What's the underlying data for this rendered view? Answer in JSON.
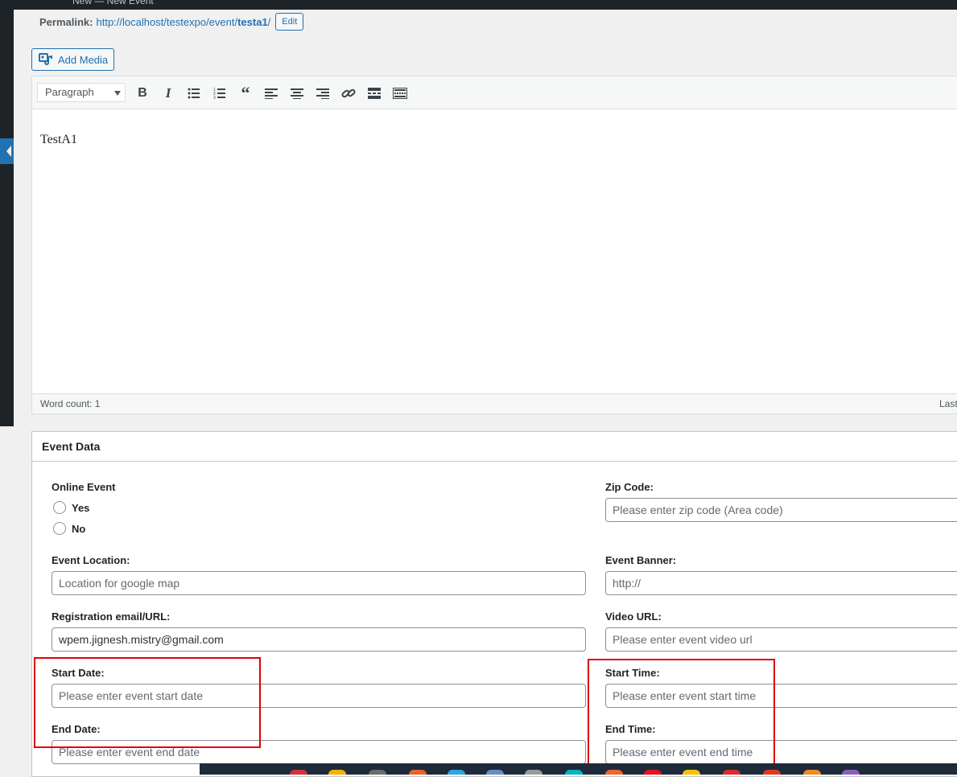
{
  "topbar": {
    "crumb": "New — New Event"
  },
  "permalink": {
    "label": "Permalink:",
    "url_base": "http://localhost/testexpo/event/",
    "slug": "testa1",
    "url_end": "/",
    "edit_label": "Edit"
  },
  "media": {
    "add_label": "Add Media"
  },
  "editor": {
    "format_value": "Paragraph",
    "toolbar_icons": [
      "bold-icon",
      "italic-icon",
      "bulleted-list-icon",
      "numbered-list-icon",
      "blockquote-icon",
      "align-left-icon",
      "align-center-icon",
      "align-right-icon",
      "link-icon",
      "read-more-icon",
      "toolbar-toggle-icon"
    ],
    "content": "TestA1",
    "word_count": "Word count: 1",
    "last_edited": "Last"
  },
  "event_data": {
    "title": "Event Data",
    "online_event": {
      "label": "Online Event",
      "option_yes": "Yes",
      "option_no": "No"
    },
    "zip_code": {
      "label": "Zip Code:",
      "placeholder": "Please enter zip code (Area code)"
    },
    "event_location": {
      "label": "Event Location:",
      "placeholder": "Location for google map"
    },
    "event_banner": {
      "label": "Event Banner:",
      "placeholder": "http://"
    },
    "registration": {
      "label": "Registration email/URL:",
      "value": "wpem.jignesh.mistry@gmail.com"
    },
    "video_url": {
      "label": "Video URL:",
      "placeholder": "Please enter event video url"
    },
    "start_date": {
      "label": "Start Date:",
      "placeholder": "Please enter event start date"
    },
    "start_time": {
      "label": "Start Time:",
      "placeholder": "Please enter event start time"
    },
    "end_date": {
      "label": "End Date:",
      "placeholder": "Please enter event end date"
    },
    "end_time": {
      "label": "End Time:",
      "placeholder": "Please enter event end time"
    }
  },
  "colors": {
    "accent": "#2271b1",
    "highlight": "#e00000",
    "admin_bar": "#1d2327"
  }
}
